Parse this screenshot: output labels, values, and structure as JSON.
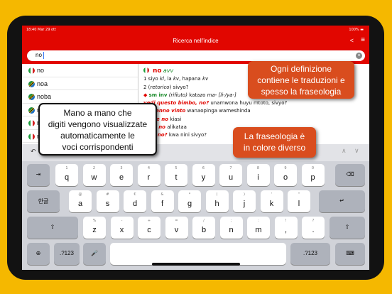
{
  "statusbar": {
    "time": "18:40   Mar 29 ott",
    "battery": "100% ▬"
  },
  "appbar": {
    "title": "Ricerca nell'indice",
    "share_icon": "share-icon",
    "menu_icon": "menu-icon"
  },
  "search": {
    "value": "no",
    "clear_icon": "clear-icon"
  },
  "results": [
    {
      "word": "no",
      "flag": "it"
    },
    {
      "word": "noa",
      "flag": "sw"
    },
    {
      "word": "noba",
      "flag": "sw"
    },
    {
      "word": "no",
      "flag": "sw"
    },
    {
      "word": "no",
      "flag": "it"
    },
    {
      "word": "no",
      "flag": "it"
    }
  ],
  "entry": {
    "headword": "no",
    "pos": "avv",
    "l1": "1 siyo",
    "l1_kl": "kl",
    "l1_mid": ", la",
    "l1_kv": "kv",
    "l1_mid2": ", hapana",
    "l1_kv2": "kv",
    "l2_num": "2 (",
    "l2_ret": "retorico",
    "l2_rest": ") sivyo?",
    "l3_sm": "sm inv",
    "l3_rif": "(rifiuto)",
    "l3_rest": "katazo",
    "l3_ma": "ma- [li-/ya-]",
    "p1_it": "vedi questo bimbo, no?",
    "p1_sw": "unamwona huyu mtoto, sivyo?",
    "p2_it": "no hanno vinto",
    "p2_sw": "wanaopinga wameshinda",
    "p3_it": "zi che no",
    "p3_sw": "kiasi",
    "p4_it": "se di no",
    "p4_sw": "alikataa",
    "p5_it": "rché no?",
    "p5_sw": "kwa nini sivyo?"
  },
  "keyboard": {
    "toolbar": {
      "undo": "↶",
      "redo": "↷",
      "up": "∧",
      "down": "∨"
    },
    "row1": [
      {
        "sub": "1",
        "key": "q"
      },
      {
        "sub": "2",
        "key": "w"
      },
      {
        "sub": "3",
        "key": "e"
      },
      {
        "sub": "4",
        "key": "r"
      },
      {
        "sub": "5",
        "key": "t"
      },
      {
        "sub": "6",
        "key": "y"
      },
      {
        "sub": "7",
        "key": "u"
      },
      {
        "sub": "8",
        "key": "i"
      },
      {
        "sub": "9",
        "key": "o"
      },
      {
        "sub": "0",
        "key": "p"
      }
    ],
    "row2": [
      {
        "sub": "@",
        "key": "a"
      },
      {
        "sub": "#",
        "key": "s"
      },
      {
        "sub": "€",
        "key": "d"
      },
      {
        "sub": "&",
        "key": "f"
      },
      {
        "sub": "*",
        "key": "g"
      },
      {
        "sub": "(",
        "key": "h"
      },
      {
        "sub": ")",
        "key": "j"
      },
      {
        "sub": "'",
        "key": "k"
      },
      {
        "sub": "\"",
        "key": "l"
      }
    ],
    "row3": [
      {
        "sub": "%",
        "key": "z"
      },
      {
        "sub": "-",
        "key": "x"
      },
      {
        "sub": "+",
        "key": "c"
      },
      {
        "sub": "=",
        "key": "v"
      },
      {
        "sub": "/",
        "key": "b"
      },
      {
        "sub": ";",
        "key": "n"
      },
      {
        "sub": ":",
        "key": "m"
      },
      {
        "sub": "!",
        "key": ","
      },
      {
        "sub": "?",
        "key": "."
      }
    ],
    "tab": "⇥",
    "backspace": "⌫",
    "hangul": "한글",
    "return": "↵",
    "shift": "⇧",
    "globe": "⊕",
    "num": ".?123",
    "mic": "🎤",
    "kbdismiss": "⌨"
  },
  "callouts": {
    "definitions": [
      "Ogni definizione",
      "contiene le traduzioni e",
      "spesso la fraseologia"
    ],
    "phraseology": [
      "La fraseologia è",
      "in colore diverso"
    ],
    "autocomplete": [
      "Mano a mano che",
      "digiti vengono visualizzate",
      "automaticamente le",
      "voci corrispondenti"
    ]
  },
  "colors": {
    "brand_red": "#e10600",
    "callout_orange": "#d94d1e",
    "background": "#f5b800"
  }
}
